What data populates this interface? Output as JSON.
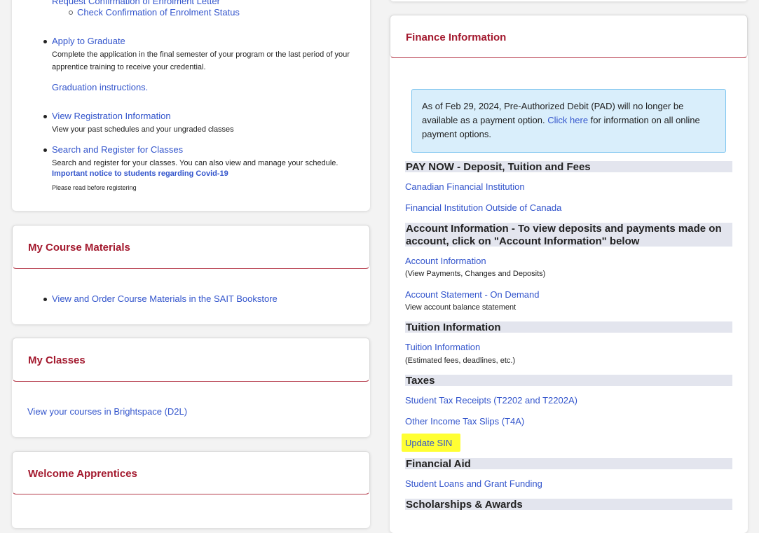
{
  "left": {
    "top_card": {
      "req_letter": "Request Confirmation of Enrolment Letter",
      "check_status": "Check Confirmation of Enrolment Status",
      "apply_graduate": "Apply to Graduate",
      "apply_desc": "Complete the application in the final semester of your program or the last period of your apprentice training to receive your credential.",
      "grad_instructions": "Graduation instructions.",
      "view_reg": "View Registration Information",
      "view_reg_desc": "View your past schedules and your ungraded classes",
      "search_register": "Search and Register for Classes",
      "search_desc": "Search and register for your classes. You can also view and manage your schedule.",
      "covid_notice": "Important notice to students regarding Covid-19",
      "covid_sub": "Please read before registering"
    },
    "course_materials": {
      "title": "My Course Materials",
      "link": "View and Order Course Materials in the SAIT Bookstore"
    },
    "my_classes": {
      "title": "My Classes",
      "link": "View your courses in Brightspace (D2L)"
    },
    "welcome": {
      "title": "Welcome Apprentices"
    }
  },
  "finance": {
    "title": "Finance Information",
    "notice_pre": "As of Feb 29, 2024, Pre-Authorized Debit (PAD) will no longer be available as a payment option.",
    "notice_link": "Click here",
    "notice_post": "for information on all online payment options.",
    "pay_now": "PAY NOW - Deposit, Tuition and Fees",
    "canadian_fi": "Canadian Financial Institution",
    "outside_fi": "Financial Institution Outside of Canada",
    "account_header": "Account Information - To view deposits and payments made on account, click on \"Account Information\" below",
    "account_info": "Account Information",
    "account_info_sub": "(View Payments, Changes and Deposits)",
    "account_statement": "Account Statement - On Demand",
    "account_statement_sub": "View account balance statement",
    "tuition_header": "Tuition Information",
    "tuition_info": "Tuition Information",
    "tuition_sub": "(Estimated fees, deadlines, etc.)",
    "taxes_header": "Taxes",
    "tax_receipts": "Student Tax Receipts (T2202 and T2202A)",
    "tax_slips": "Other Income Tax Slips (T4A)",
    "update_sin": "Update SIN",
    "aid_header": "Financial Aid",
    "loans": "Student Loans and Grant Funding",
    "scholarships_header": "Scholarships & Awards"
  },
  "colors": {
    "title_red": "#a3192e",
    "link_blue": "#3355cc",
    "notice_bg": "#d9eefb",
    "highlight": "#ffff33"
  }
}
